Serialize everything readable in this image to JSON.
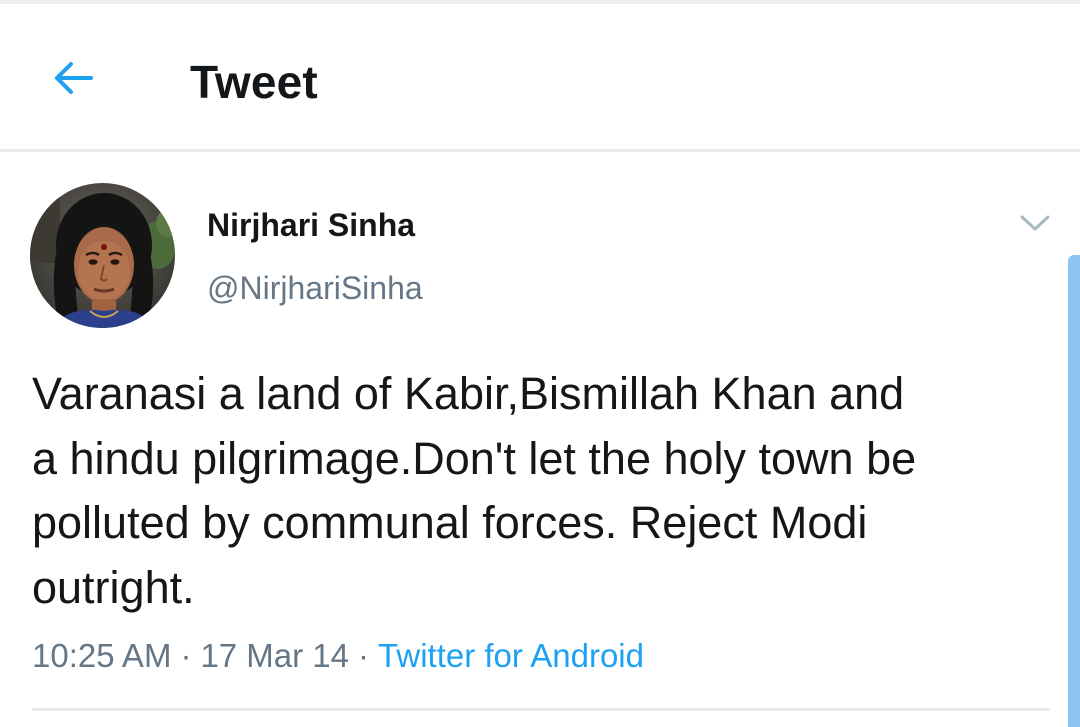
{
  "header": {
    "title": "Tweet",
    "back_icon": "arrow-left-icon"
  },
  "tweet": {
    "author": {
      "display_name": "Nirjhari Sinha",
      "handle": "@NirjhariSinha"
    },
    "text": "Varanasi a land of Kabir,Bismillah Khan and\na hindu pilgrimage.Don't let the holy town be\npolluted by communal forces. Reject Modi\noutright.",
    "time": "10:25 AM",
    "date": "17 Mar 14",
    "separator": "·",
    "source": "Twitter for Android"
  },
  "colors": {
    "accent": "#1da1f2",
    "text_primary": "#14171a",
    "text_secondary": "#657786",
    "divider": "#e6ecf0",
    "scrollbar": "#8ec4f0"
  }
}
